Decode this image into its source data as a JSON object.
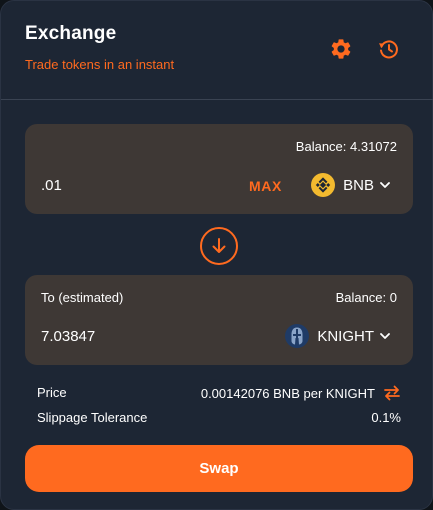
{
  "header": {
    "title": "Exchange",
    "subtitle": "Trade tokens in an instant",
    "settings_icon": "gear-icon",
    "history_icon": "history-icon"
  },
  "from": {
    "balance": "Balance: 4.31072",
    "amount": ".01",
    "max_label": "MAX",
    "token": {
      "symbol": "BNB",
      "icon": "bnb-icon"
    }
  },
  "switch_icon": "arrow-down-circle-icon",
  "to": {
    "label": "To (estimated)",
    "balance": "Balance: 0",
    "amount": "7.03847",
    "token": {
      "symbol": "KNIGHT",
      "icon": "knight-helmet-icon"
    }
  },
  "details": {
    "price_label": "Price",
    "price_value": "0.00142076 BNB per KNIGHT",
    "slippage_label": "Slippage Tolerance",
    "slippage_value": "0.1%"
  },
  "swap_button": "Swap",
  "colors": {
    "accent": "#ff6a1f",
    "card_bg": "#1d2634",
    "panel_bg": "#3e3835",
    "bnb_yellow": "#f3ba2f"
  }
}
